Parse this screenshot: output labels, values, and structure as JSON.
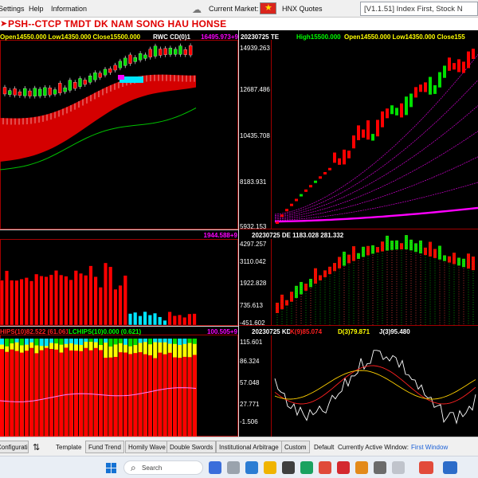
{
  "menu": {
    "items": [
      "Settings",
      "Help",
      "Information"
    ],
    "current_market_label": "Current Market:",
    "market_value": "HNX Quotes",
    "version_text": "[V1.1.51] Index First, Stock N"
  },
  "title": {
    "arrow": "➤",
    "text": "PSH--CTCP TMDT DK NAM SONG HAU  HONSE"
  },
  "panels": {
    "p1": {
      "ohlc": "Open14550.000 Low14350.000 Close15500.000",
      "rwc": "RWC CD(0)1",
      "value": "16495.973+9"
    },
    "p2": {
      "date": "20230725 TE",
      "high": "High15500.000",
      "rest": "Open14550.000 Low14350.000 Close155",
      "ticks": [
        "14939.263",
        "12687.486",
        "10435.708",
        "8183.931",
        "5932.153"
      ]
    },
    "p3": {
      "value": "1944.588+9"
    },
    "p4": {
      "label": "20230725 DE 1183.028 281.332",
      "ticks": [
        "4297.257",
        "3110.042",
        "1922.828",
        "735.613",
        "-451.602"
      ]
    },
    "p5": {
      "hips": "HIPS(10)82.522 (61.061)",
      "lchips": "LCHIPS(10)0.000 (0.621)",
      "value": "100.505+9"
    },
    "p6": {
      "label": "20230725 KDJ",
      "k": "K(9)85.074",
      "d": "D(3)79.871",
      "j": "J(3)95.480",
      "ticks": [
        "115.601",
        "86.324",
        "57.048",
        "27.771",
        "-1.506"
      ]
    }
  },
  "toolbar": {
    "configurations": "Configurations",
    "sort_icon": "up-down-arrows-icon",
    "template_label": "Template",
    "buttons": [
      "Fund Trend",
      "Homily Wave",
      "Double Swords",
      "Institutional Arbitrage",
      "Custom"
    ],
    "default_label": "Default",
    "active_window_label": "Currently Active Window:",
    "active_window_value": "First Window"
  },
  "taskbar": {
    "search_placeholder": "Search"
  },
  "colors": {
    "up": "#ff0000",
    "down": "#00e000",
    "magenta": "#ff00ff",
    "cyan": "#00e5ff",
    "yellow": "#ffff00",
    "accent_blue": "#1a5fd6"
  }
}
